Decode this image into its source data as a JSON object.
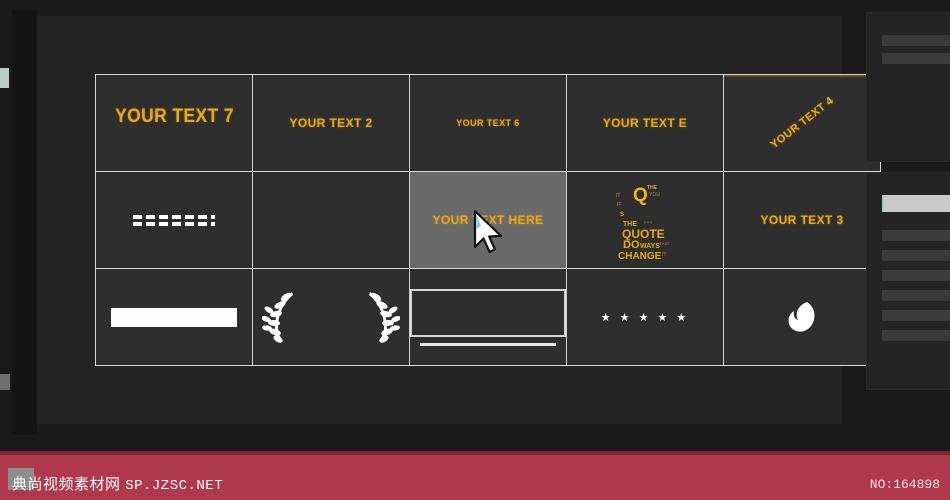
{
  "app": {
    "background_color": "#1a1a1a",
    "panel_color": "#232323",
    "accent_color": "#e8a817",
    "grid_line_color": "#d8d8d8",
    "selection_color": "#6a6a6a"
  },
  "preview": {
    "grid": {
      "columns": 5,
      "rows": 3,
      "cells": [
        {
          "id": "r1c1",
          "type": "text-title",
          "label": "YOUR TEXT 7",
          "size": "large",
          "clipped": true,
          "selected": false
        },
        {
          "id": "r1c2",
          "type": "text-title",
          "label": "YOUR TEXT 2",
          "size": "medium",
          "selected": false
        },
        {
          "id": "r1c3",
          "type": "text-title",
          "label": "YOUR TEXT 6",
          "size": "small",
          "selected": false
        },
        {
          "id": "r1c4",
          "type": "text-title",
          "label": "YOUR TEXT E",
          "size": "medium",
          "selected": false
        },
        {
          "id": "r1c5",
          "type": "text-title-rotated",
          "label": "YOUR TEXT 4",
          "rotation_deg": -38,
          "selected": false,
          "accent_border": true
        },
        {
          "id": "r2c1",
          "type": "dashes-graphic",
          "label": "",
          "selected": false
        },
        {
          "id": "r2c2",
          "type": "empty",
          "label": "",
          "selected": false
        },
        {
          "id": "r2c3",
          "type": "text-title",
          "label": "YOUR TEXT HERE",
          "size": "medium",
          "selected": true
        },
        {
          "id": "r2c4",
          "type": "quote-typography",
          "label": "",
          "selected": false
        },
        {
          "id": "r2c5",
          "type": "text-title",
          "label": "YOUR TEXT 3",
          "size": "medium",
          "selected": false
        },
        {
          "id": "r3c1",
          "type": "white-bar-graphic",
          "label": "",
          "selected": false
        },
        {
          "id": "r3c2",
          "type": "laurel-wreath-graphic",
          "label": "",
          "selected": false
        },
        {
          "id": "r3c3",
          "type": "frame-box-graphic",
          "label": "",
          "selected": false
        },
        {
          "id": "r3c4",
          "type": "stars-graphic",
          "label": "★ ★ ★ ★ ★",
          "selected": false
        },
        {
          "id": "r3c5",
          "type": "leaf-graphic",
          "label": "",
          "selected": false
        }
      ]
    },
    "quote_graphic": {
      "letter": "Q",
      "word_the_top": "THE",
      "word_you": "YOU",
      "mark_left_1": "IT",
      "mark_left_2": "IF",
      "mark_left_3": "S",
      "word_the": "THE",
      "dots": "• • •",
      "word_quote": "QUOTE",
      "word_do": "DO",
      "word_ways": "WAYS",
      "word_that": "THAT",
      "word_change": "CHANGE",
      "tail": "IT"
    }
  },
  "sidebar": {
    "top_panel": {
      "rows": 2
    },
    "bottom_panel": {
      "rows": 7,
      "highlighted_index": 0
    }
  },
  "watermark": {
    "site_name_cn": "典尚视频素材网",
    "site_url": "SP.JZSC.NET",
    "item_number": "NO:164898",
    "bar_color": "#b0384d"
  }
}
